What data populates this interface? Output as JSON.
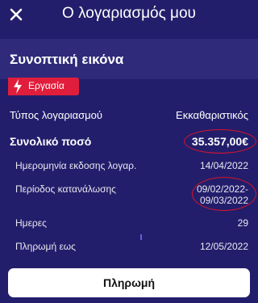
{
  "header": {
    "close_icon": "close-icon",
    "title": "Ο λογαριασμός μου"
  },
  "section": {
    "title": "Συνοπτική εικόνα"
  },
  "tag": {
    "icon": "lightning-icon",
    "label": "Εργασία",
    "color": "#e01e3c"
  },
  "details": {
    "account_type_label": "Τύπος λογαριασμού",
    "account_type_value": "Εκκαθαριστικός",
    "total_label": "Συνολικό ποσό",
    "total_value": "35.357,00€",
    "issue_date_label": "Ημερομηνία εκδοσης λογαρ.",
    "issue_date_value": "14/04/2022",
    "period_label": "Περίοδος κατανάλωσης",
    "period_from": "09/02/2022-",
    "period_to": "09/03/2022",
    "days_label": "Ημερες",
    "days_value": "29",
    "due_label": "Πληρωμή εως",
    "due_value": "12/05/2022"
  },
  "actions": {
    "pay_label": "Πληρωμή"
  },
  "colors": {
    "background": "#231e6b",
    "accent_red": "#e01e3c",
    "highlight_ellipse": "#d5142c"
  }
}
